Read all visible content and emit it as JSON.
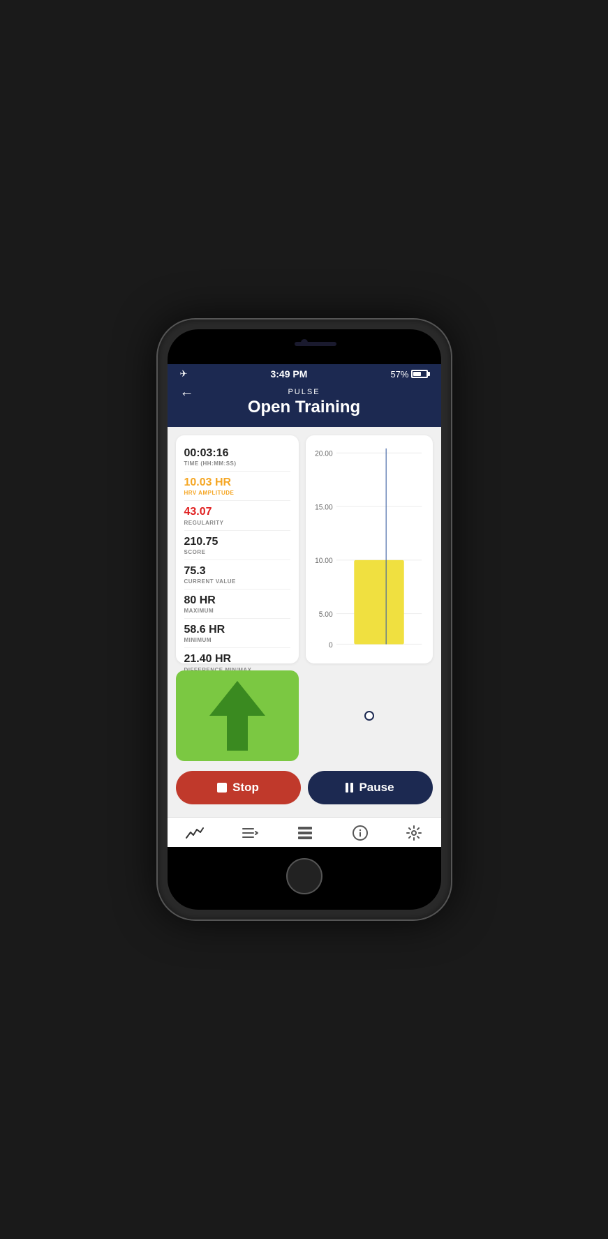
{
  "device": {
    "camera": true,
    "speaker": true
  },
  "status_bar": {
    "time": "3:49 PM",
    "battery_percent": "57%",
    "airplane_mode": true
  },
  "header": {
    "app_name": "PULSE",
    "title": "Open Training",
    "back_label": "←"
  },
  "stats": [
    {
      "value": "00:03:16",
      "label": "TIME (HH:MM:SS)",
      "color": "normal"
    },
    {
      "value": "10.03 HR",
      "label": "HRV AMPLITUDE",
      "color": "orange"
    },
    {
      "value": "43.07",
      "label": "REGULARITY",
      "color": "red"
    },
    {
      "value": "210.75",
      "label": "SCORE",
      "color": "normal"
    },
    {
      "value": "75.3",
      "label": "CURRENT VALUE",
      "color": "normal"
    },
    {
      "value": "80 HR",
      "label": "MAXIMUM",
      "color": "normal"
    },
    {
      "value": "58.6 HR",
      "label": "MINIMUM",
      "color": "normal"
    },
    {
      "value": "21.40 HR",
      "label": "DIFFERENCE MIN/MAX",
      "color": "normal"
    }
  ],
  "chart": {
    "y_labels": [
      "20.00",
      "15.00",
      "10.00",
      "5.00",
      "0"
    ],
    "bar_value": 10,
    "bar_max": 22,
    "bar_color": "#f0e040",
    "line_color": "#3a5fa0"
  },
  "controls": {
    "stop_label": "Stop",
    "pause_label": "Pause",
    "stop_color": "#c0392b",
    "pause_color": "#1c2951"
  },
  "tab_bar": {
    "items": [
      {
        "icon": "chart-line",
        "name": "activity-tab"
      },
      {
        "icon": "list-play",
        "name": "training-tab"
      },
      {
        "icon": "sessions-tab",
        "name": "sessions-tab"
      },
      {
        "icon": "info-tab",
        "name": "info-tab"
      },
      {
        "icon": "settings-tab",
        "name": "settings-tab"
      }
    ]
  }
}
